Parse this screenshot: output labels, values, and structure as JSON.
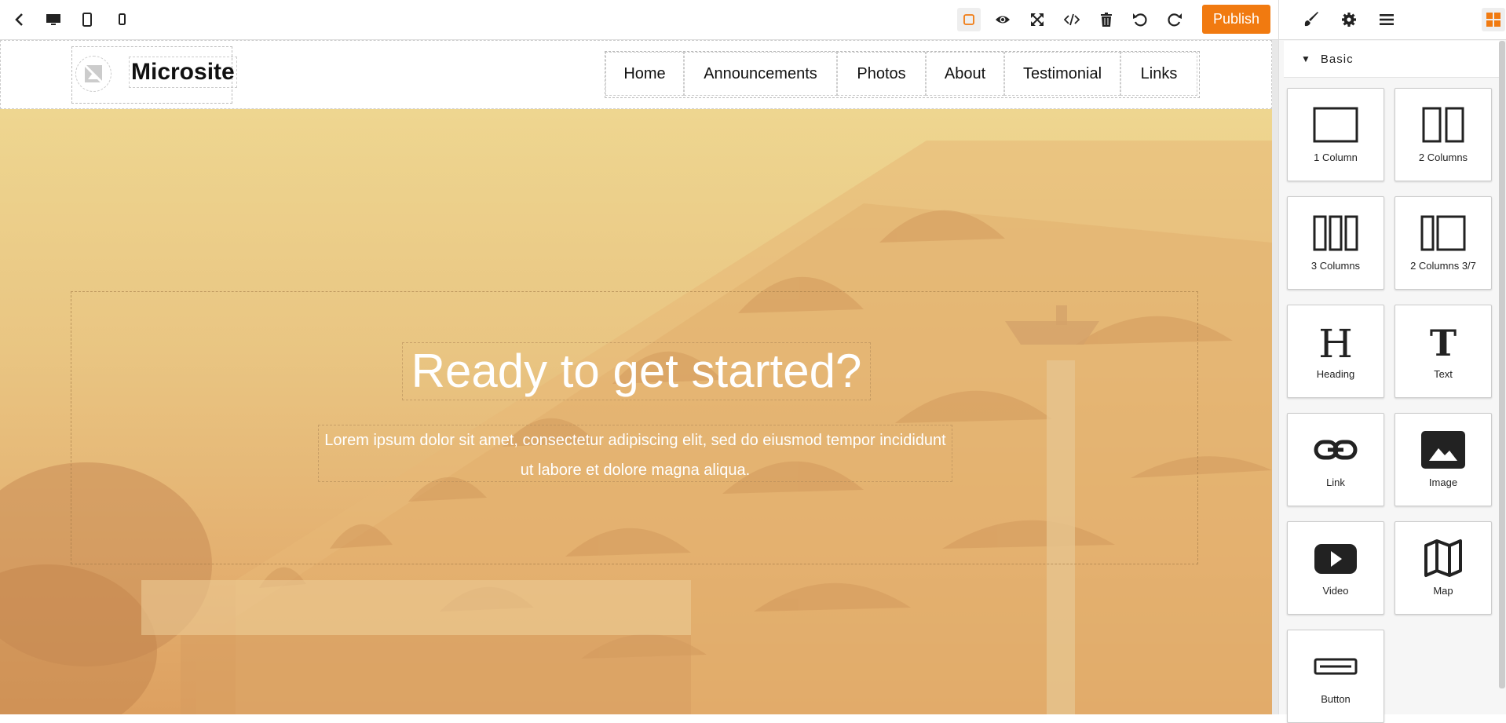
{
  "toolbar": {
    "publish_label": "Publish",
    "left_icons": [
      "back-icon",
      "desktop-icon",
      "tablet-icon",
      "mobile-icon"
    ],
    "right_icons": [
      "square-outline-icon",
      "eye-icon",
      "fullscreen-icon",
      "code-icon",
      "trash-icon",
      "undo-icon",
      "redo-icon"
    ],
    "accent": "#f17a10"
  },
  "panel": {
    "tabs": [
      "brush-icon",
      "gear-icon",
      "menu-icon",
      "blocks-icon"
    ],
    "category": "Basic",
    "blocks": [
      {
        "label": "1 Column",
        "icon": "one-column-icon"
      },
      {
        "label": "2 Columns",
        "icon": "two-columns-icon"
      },
      {
        "label": "3 Columns",
        "icon": "three-columns-icon"
      },
      {
        "label": "2 Columns 3/7",
        "icon": "two-columns-3-7-icon"
      },
      {
        "label": "Heading",
        "icon": "heading-icon"
      },
      {
        "label": "Text",
        "icon": "text-icon"
      },
      {
        "label": "Link",
        "icon": "link-icon"
      },
      {
        "label": "Image",
        "icon": "image-icon"
      },
      {
        "label": "Video",
        "icon": "video-icon"
      },
      {
        "label": "Map",
        "icon": "map-icon"
      },
      {
        "label": "Button",
        "icon": "button-icon"
      }
    ]
  },
  "site": {
    "title": "Microsite",
    "nav": [
      "Home",
      "Announcements",
      "Photos",
      "About",
      "Testimonial",
      "Links"
    ],
    "hero_title": "Ready to get started?",
    "hero_text": "Lorem ipsum dolor sit amet, consectetur adipiscing elit, sed do eiusmod tempor incididunt ut labore et dolore magna aliqua."
  }
}
